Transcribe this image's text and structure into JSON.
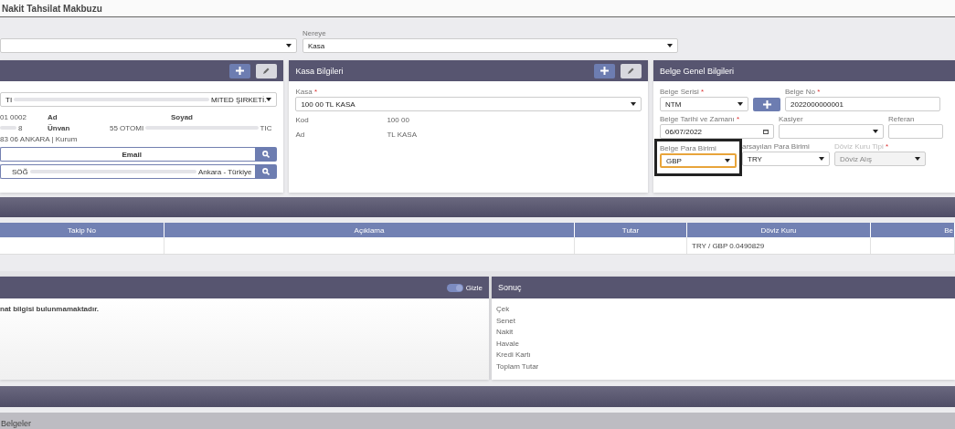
{
  "title": "Nakit Tahsilat Makbuzu",
  "destination": {
    "label": "Nereye",
    "value": "Kasa"
  },
  "customer_panel": {
    "actions": [
      {
        "kind": "add"
      },
      {
        "kind": "edit"
      }
    ],
    "account_select": {
      "parts": [
        {
          "kind": "text",
          "text": "TI"
        },
        {
          "kind": "blur"
        },
        {
          "kind": "text",
          "text": "MITED ŞIRKETİ."
        }
      ]
    },
    "details": [
      {
        "cells": [
          {
            "kind": "value",
            "parts": [
              {
                "kind": "text",
                "text": "01 0002"
              }
            ]
          },
          {
            "kind": "label",
            "parts": [
              {
                "kind": "text",
                "text": "Ad"
              }
            ]
          },
          {
            "kind": "label",
            "parts": [
              {
                "kind": "text",
                "text": "Soyad"
              }
            ]
          }
        ]
      },
      {
        "cells": [
          {
            "kind": "value",
            "parts": [
              {
                "kind": "blur"
              },
              {
                "kind": "text",
                "text": "8"
              }
            ]
          },
          {
            "kind": "label",
            "parts": [
              {
                "kind": "text",
                "text": "Ünvan"
              }
            ]
          },
          {
            "kind": "value",
            "parts": [
              {
                "kind": "text",
                "text": "55 OTOMI"
              },
              {
                "kind": "blur"
              },
              {
                "kind": "text",
                "text": "TIC"
              }
            ]
          }
        ]
      },
      {
        "cells": [
          {
            "kind": "value",
            "parts": [
              {
                "kind": "text",
                "text": "83 06 ANKARA | Kurum"
              }
            ]
          }
        ]
      }
    ],
    "email_field": {
      "label": "Email"
    },
    "address_field": {
      "parts": [
        {
          "kind": "text",
          "text": "SÖĞ"
        },
        {
          "kind": "blur"
        },
        {
          "kind": "text",
          "text": "Ankara - Türkiye"
        }
      ]
    }
  },
  "kasa_panel": {
    "title": "Kasa Bilgileri",
    "actions": [
      {
        "kind": "add"
      },
      {
        "kind": "edit"
      }
    ],
    "select": {
      "label": "Kasa",
      "required_mark": "*",
      "value": "100 00 TL KASA"
    },
    "info": [
      {
        "label": "Kod",
        "value": "100 00"
      },
      {
        "label": "Ad",
        "value": "TL KASA"
      }
    ]
  },
  "document_panel": {
    "title": "Belge Genel Bilgileri",
    "rows": [
      [
        {
          "kind": "select",
          "label": "Belge Serisi",
          "required_mark": "*",
          "value": "NTM",
          "highlighted": false,
          "focused": false,
          "disabled": false
        },
        {
          "kind": "add"
        },
        {
          "kind": "input",
          "label": "Belge No",
          "required_mark": "*",
          "value": "2022000000001",
          "highlighted": false,
          "focused": false,
          "disabled": false
        }
      ],
      [
        {
          "kind": "date",
          "label": "Belge Tarihi ve Zamanı",
          "required_mark": "*",
          "value": "06/07/2022",
          "highlighted": false,
          "focused": false,
          "disabled": false
        },
        {
          "kind": "select",
          "label": "Kasiyer",
          "highlighted": false,
          "focused": false,
          "disabled": false
        },
        {
          "kind": "input",
          "label": "Referan",
          "highlighted": false,
          "focused": false,
          "disabled": false
        }
      ],
      [
        {
          "kind": "select",
          "label": "Belge Para Birimi",
          "value": "GBP",
          "highlighted": true,
          "focused": true,
          "disabled": false
        },
        {
          "kind": "select",
          "label": "arsayılan Para Birimi",
          "value": "TRY",
          "highlighted": false,
          "focused": false,
          "disabled": false
        },
        {
          "kind": "select",
          "label": "Döviz Kuru Tipi",
          "required_mark": "*",
          "value": "Döviz Alış",
          "highlighted": false,
          "focused": false,
          "disabled": true
        }
      ]
    ]
  },
  "table": {
    "columns": [
      "Takip No",
      "Açıklama",
      "Tutar",
      "Döviz Kuru",
      "Be"
    ],
    "rows": [
      [
        null,
        null,
        null,
        "TRY / GBP 0.0490829",
        null
      ]
    ]
  },
  "payment_panel": {
    "toggle": {
      "label": "Gizle",
      "on": true
    },
    "message": "nat bilgisi bulunmamaktadır."
  },
  "result_panel": {
    "title": "Sonuç",
    "items": [
      "Çek",
      "Senet",
      "Nakit",
      "Havale",
      "Kredi Kartı",
      "Toplam Tutar"
    ]
  },
  "documents_bar": {
    "title": "Belgeler"
  }
}
